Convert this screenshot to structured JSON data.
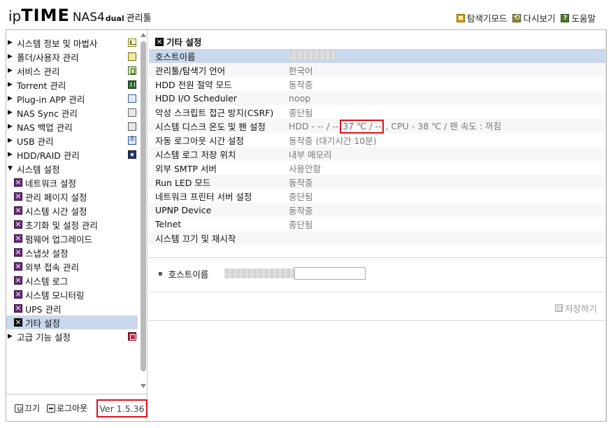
{
  "header": {
    "logo_ip": "ip",
    "logo_time": "TIME",
    "logo_model": "NAS4",
    "logo_dual": "dual",
    "logo_manager": "관리툴",
    "links": [
      {
        "label": "탐색기모드",
        "icon": "explorer-icon"
      },
      {
        "label": "다시보기",
        "icon": "refresh-icon"
      },
      {
        "label": "도움말",
        "icon": "help-icon"
      }
    ]
  },
  "sidebar": {
    "menu": [
      {
        "label": "시스템 정보 및 마법사",
        "icon": "info-icon"
      },
      {
        "label": "폴더/사용자 관리",
        "icon": "folder-icon"
      },
      {
        "label": "서비스 관리",
        "icon": "service-icon"
      },
      {
        "label": "Torrent 관리",
        "icon": "torrent-icon"
      },
      {
        "label": "Plug-in APP 관리",
        "icon": "plugin-icon"
      },
      {
        "label": "NAS Sync 관리",
        "icon": "sync-icon"
      },
      {
        "label": "NAS 백업 관리",
        "icon": "backup-icon"
      },
      {
        "label": "USB 관리",
        "icon": "usb-icon"
      },
      {
        "label": "HDD/RAID 관리",
        "icon": "hdd-icon"
      }
    ],
    "system_settings_label": "시스템 설정",
    "submenu": [
      "네트워크 설정",
      "관리 페이지 설정",
      "시스템 시간 설정",
      "초기화 및 설정 관리",
      "펌웨어 업그레이드",
      "스냅샷 설정",
      "외부 접속 관리",
      "시스템 로그",
      "시스템 모니터링",
      "UPS 관리",
      "기타 설정"
    ],
    "active_submenu": "기타 설정",
    "advanced_label": "고급 기능 설정",
    "footer": {
      "off_label": "끄기",
      "logout_label": "로그아웃",
      "version": "Ver 1.5.36"
    }
  },
  "content": {
    "section_title": "기타 설정",
    "rows": [
      {
        "key": "호스트이름",
        "value": ""
      },
      {
        "key": "관리툴/탐색기 언어",
        "value": "한국어"
      },
      {
        "key": "HDD 전원 절약 모드",
        "value": "동작중"
      },
      {
        "key": "HDD I/O Scheduler",
        "value": "noop"
      },
      {
        "key": "악성 스크립트 접근 방지(CSRF)",
        "value": "중단됨"
      },
      {
        "key": "시스템 디스크 온도 및 팬 설정",
        "value_pre": "HDD - -- / --",
        "value_highlight": "37 ℃ / --",
        "value_post": ", CPU - 38 ℃ / 팬 속도 : 꺼짐"
      },
      {
        "key": "자동 로그아웃 시간 설정",
        "value": "동작중 (대기시간 10분)"
      },
      {
        "key": "시스템 로그 저장 위치",
        "value": "내부 메모리"
      },
      {
        "key": "외부 SMTP 서버",
        "value": "사용안함"
      },
      {
        "key": "Run LED 모드",
        "value": "동작중"
      },
      {
        "key": "네트워크 프린터 서버 설정",
        "value": "중단됨"
      },
      {
        "key": "UPNP Device",
        "value": "동작중"
      },
      {
        "key": "Telnet",
        "value": "중단됨"
      },
      {
        "key": "시스템 끄기 및 재시작",
        "value": ""
      }
    ],
    "edit": {
      "label": "호스트이름",
      "input_value": ""
    },
    "save_label": "저장하기"
  }
}
